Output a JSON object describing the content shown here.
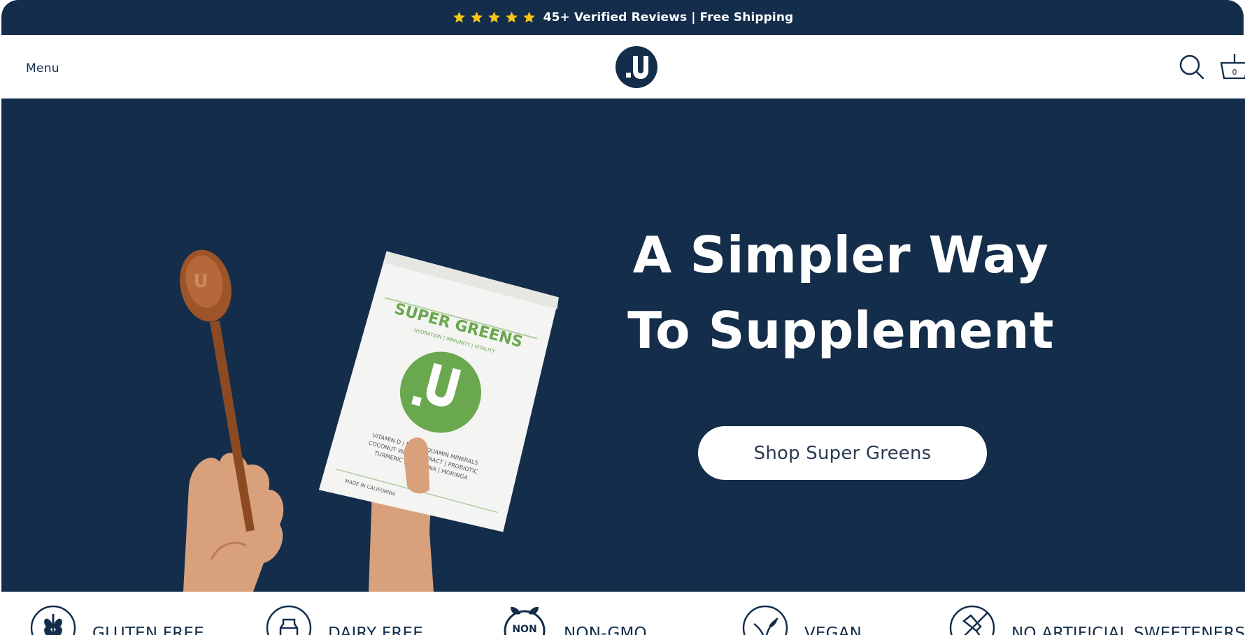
{
  "announcement": {
    "text": "45+ Verified Reviews | Free Shipping",
    "star_icon": "star-icon",
    "star_color": "#f5c518"
  },
  "header": {
    "menu_label": "Menu",
    "logo_icon": "brand-logo-icon",
    "search_icon": "search-icon",
    "cart_icon": "cart-icon",
    "cart_count": "0"
  },
  "hero": {
    "title_line1": "A Simpler Way",
    "title_line2": "To Supplement",
    "cta_label": "Shop Super Greens",
    "background_color": "#132d4b",
    "product": {
      "name": "SUPER GREENS",
      "tagline": "HYDRATION | IMMUNITY | VITALITY",
      "ingredients_line1": "VITAMIN D | MCT | AQUAMIN MINERALS",
      "ingredients_line2": "COCONUT WATER EXTRACT | PROBIOTIC",
      "ingredients_line3": "TURMERIC | SPIRULINA | MORINGA",
      "made_in": "MADE IN CALIFORNIA",
      "accent_color": "#6aa84f"
    }
  },
  "features": [
    {
      "label": "GLUTEN FREE",
      "icon": "wheat-icon"
    },
    {
      "label": "DAIRY FREE",
      "icon": "milk-carton-icon"
    },
    {
      "label": "NON-GMO",
      "icon": "non-gmo-icon",
      "badge_text": "NON"
    },
    {
      "label": "VEGAN",
      "icon": "leaf-icon"
    },
    {
      "label": "NO ARTIFICIAL SWEETENERS",
      "icon": "no-dropper-icon"
    }
  ],
  "colors": {
    "navy": "#132d4b",
    "white": "#ffffff",
    "green": "#6aa84f"
  }
}
